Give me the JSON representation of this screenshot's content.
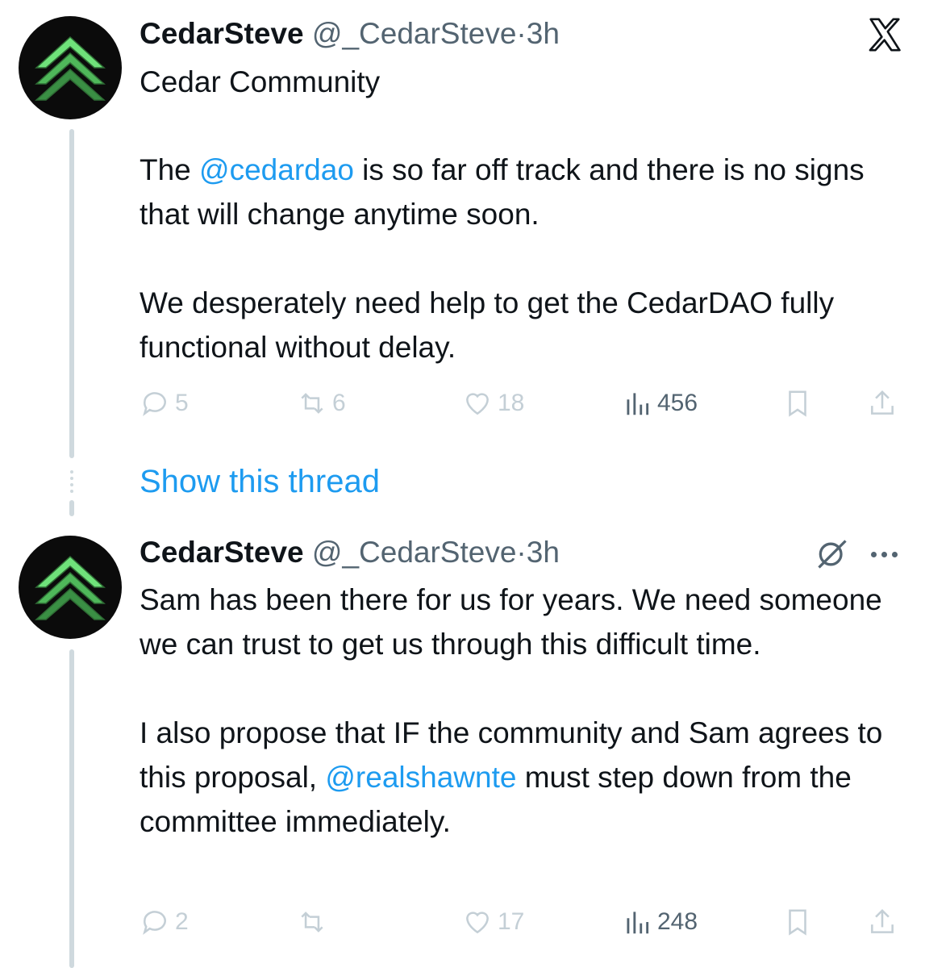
{
  "brand": {
    "logo_icon": "x-logo-icon"
  },
  "colors": {
    "link": "#1d9bf0",
    "secondary": "#536471",
    "faded": "#c4cfd6",
    "avatar_bg": "#0b0b0b",
    "avatar_accent": "#5fd36a"
  },
  "tweets": [
    {
      "name": "CedarSteve",
      "handle": "@_CedarSteve",
      "separator": "·",
      "time": "3h",
      "community": "Cedar Community",
      "body": {
        "p1_before": "The ",
        "p1_mention": "@cedardao",
        "p1_after": " is so far off track and there is no signs that will change anytime soon.",
        "p2": "We desperately need help to get the CedarDAO fully functional without delay."
      },
      "stats": {
        "replies": "5",
        "reposts": "6",
        "likes": "18",
        "views": "456"
      }
    },
    {
      "name": "CedarSteve",
      "handle": "@_CedarSteve",
      "separator": "·",
      "time": "3h",
      "body": {
        "p1": "Sam has been there for us for years. We need someone we can trust to get us through this difficult time.",
        "p2_before": "I also propose that IF the community and Sam agrees to this proposal, ",
        "p2_mention": "@realshawnte",
        "p2_after": " must step down from the committee immediately."
      },
      "stats": {
        "replies": "2",
        "reposts": "",
        "likes": "17",
        "views": "248"
      }
    }
  ],
  "show_thread_label": "Show this thread"
}
